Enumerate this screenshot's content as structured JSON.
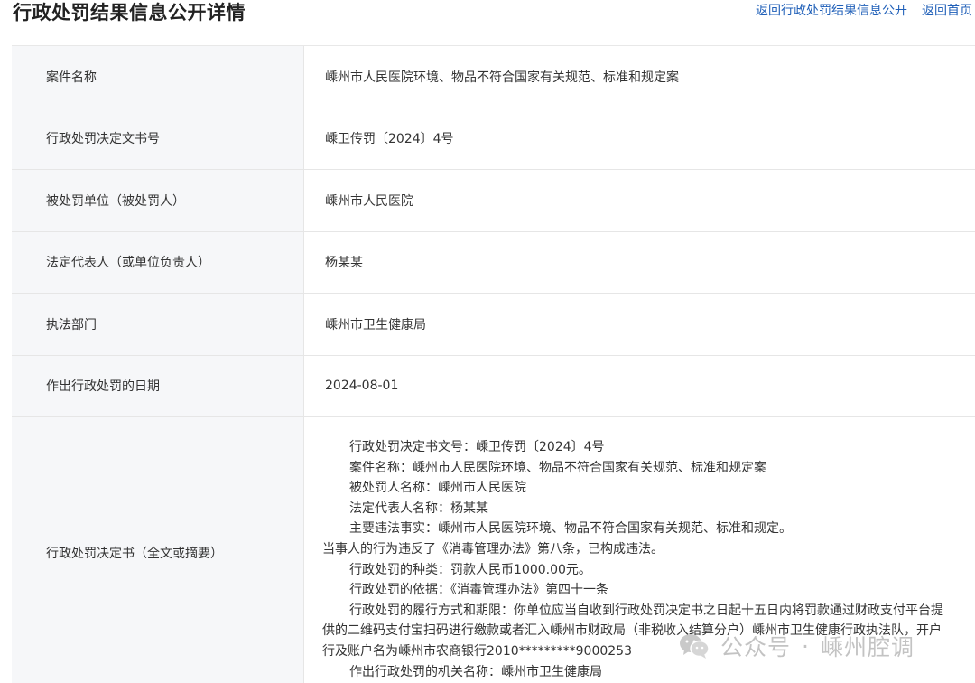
{
  "header": {
    "title": "行政处罚结果信息公开详情",
    "links": [
      "返回行政处罚结果信息公开",
      "返回首页"
    ]
  },
  "rows": [
    {
      "label": "案件名称",
      "value": "嵊州市人民医院环境、物品不符合国家有关规范、标准和规定案"
    },
    {
      "label": "行政处罚决定文书号",
      "value": "嵊卫传罚〔2024〕4号"
    },
    {
      "label": "被处罚单位（被处罚人）",
      "value": "嵊州市人民医院"
    },
    {
      "label": "法定代表人（或单位负责人）",
      "value": "杨某某"
    },
    {
      "label": "执法部门",
      "value": "嵊州市卫生健康局"
    },
    {
      "label": "作出行政处罚的日期",
      "value": "2024-08-01"
    }
  ],
  "decision": {
    "label": "行政处罚决定书（全文或摘要）",
    "lines": [
      "行政处罚决定书文号：嵊卫传罚〔2024〕4号",
      "案件名称：嵊州市人民医院环境、物品不符合国家有关规范、标准和规定案",
      "被处罚人名称：嵊州市人民医院",
      "法定代表人名称：杨某某",
      "主要违法事实：嵊州市人民医院环境、物品不符合国家有关规范、标准和规定。",
      "当事人的行为违反了《消毒管理办法》第八条，已构成违法。",
      "行政处罚的种类：罚款人民币1000.00元。",
      "行政处罚的依据：《消毒管理办法》第四十一条",
      "行政处罚的履行方式和期限：你单位应当自收到行政处罚决定书之日起十五日内将罚款通过财政支付平台提供的二维码支付宝扫码进行缴款或者汇入嵊州市财政局（非税收入结算分户）嵊州市卫生健康行政执法队，开户行及账户名为嵊州市农商银行2010*********9000253",
      "作出行政处罚的机关名称：嵊州市卫生健康局"
    ]
  },
  "watermark": {
    "source": "公众号",
    "separator": "·",
    "name": "嵊州腔调",
    "icon": "wechat-icon"
  }
}
